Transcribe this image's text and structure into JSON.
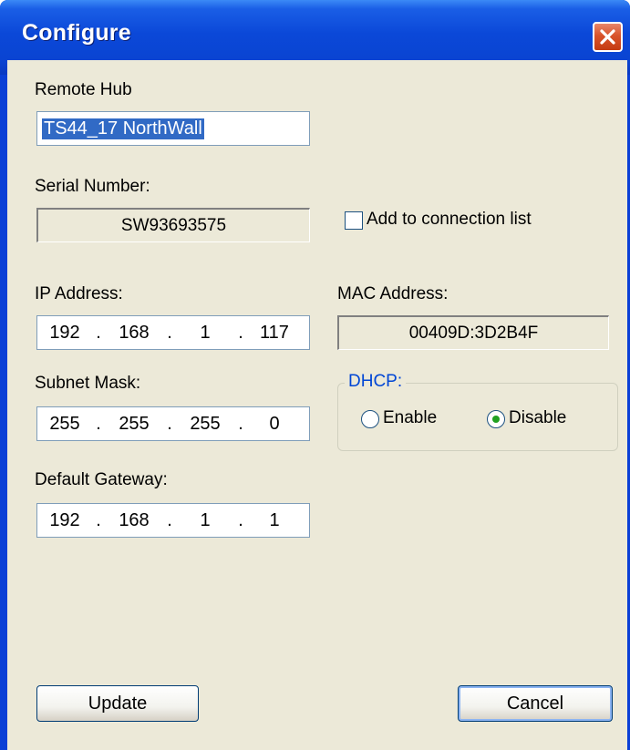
{
  "window": {
    "title": "Configure"
  },
  "remote_hub": {
    "label": "Remote Hub",
    "value": "TS44_17 NorthWall"
  },
  "serial_number": {
    "label": "Serial Number:",
    "value": "SW93693575"
  },
  "add_to_connection_list": {
    "label": "Add to connection list",
    "checked": false
  },
  "ip_address": {
    "label": "IP Address:",
    "octets": [
      "192",
      "168",
      "1",
      "117"
    ]
  },
  "mac_address": {
    "label": "MAC Address:",
    "value": "00409D:3D2B4F"
  },
  "subnet_mask": {
    "label": "Subnet Mask:",
    "octets": [
      "255",
      "255",
      "255",
      "0"
    ]
  },
  "dhcp": {
    "label": "DHCP:",
    "options": [
      {
        "label": "Enable",
        "selected": false
      },
      {
        "label": "Disable",
        "selected": true
      }
    ]
  },
  "default_gateway": {
    "label": "Default Gateway:",
    "octets": [
      "192",
      "168",
      "1",
      "1"
    ]
  },
  "buttons": {
    "update": "Update",
    "cancel": "Cancel"
  },
  "colors": {
    "title_bar": "#0a44d2",
    "dialog_bg": "#ece9d8",
    "group_title": "#0046d5",
    "selection": "#316ac5",
    "radio_dot": "#21a121",
    "close_button": "#d9532b"
  },
  "icons": {
    "close": "close-icon"
  }
}
